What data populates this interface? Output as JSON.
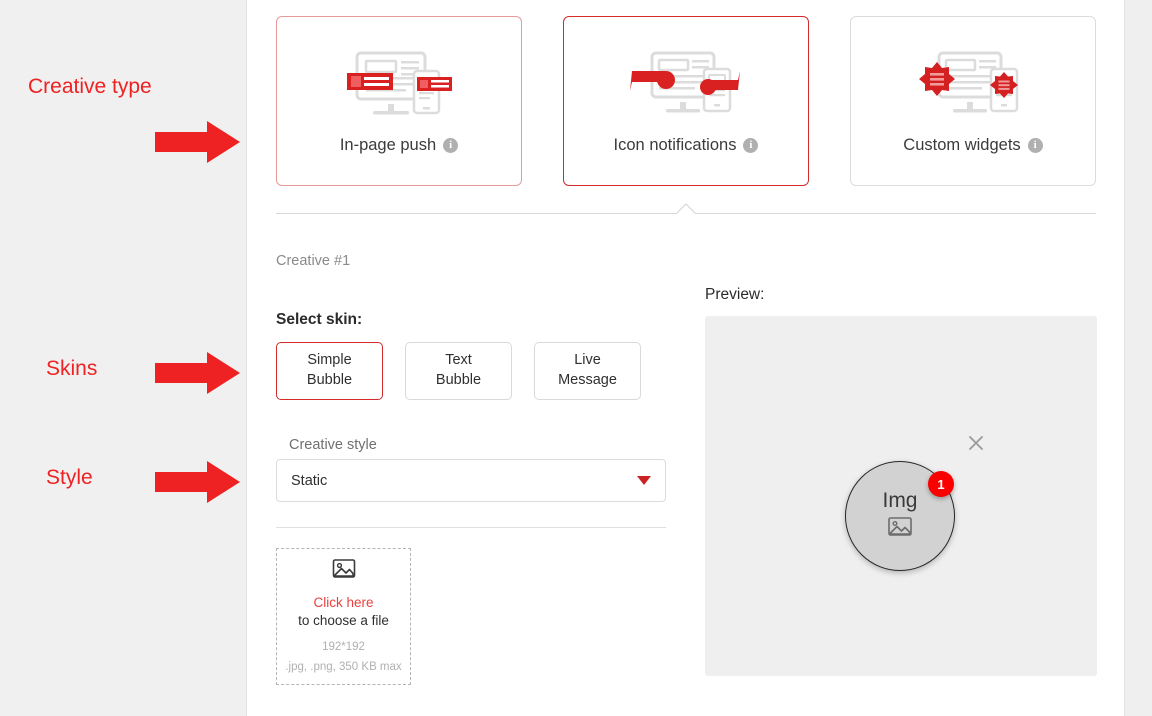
{
  "annotations": [
    {
      "label": "Creative type",
      "icon": "right-arrow-icon"
    },
    {
      "label": "Skins",
      "icon": "right-arrow-icon"
    },
    {
      "label": "Style",
      "icon": "right-arrow-icon"
    }
  ],
  "creative_type": {
    "cards": [
      {
        "label": "In-page push",
        "icon": "in-page-push-icon",
        "info": "i",
        "state": "soft-selected"
      },
      {
        "label": "Icon notifications",
        "icon": "icon-notifications-icon",
        "info": "i",
        "state": "selected"
      },
      {
        "label": "Custom widgets",
        "icon": "custom-widgets-icon",
        "info": "i",
        "state": "unselected"
      }
    ]
  },
  "creative": {
    "index_label": "Creative #1",
    "select_skin_label": "Select skin:",
    "skins": [
      {
        "line1": "Simple",
        "line2": "Bubble",
        "selected": true
      },
      {
        "line1": "Text",
        "line2": "Bubble",
        "selected": false
      },
      {
        "line1": "Live",
        "line2": "Message",
        "selected": false
      }
    ],
    "style": {
      "label": "Creative style",
      "value": "Static",
      "caret": "chevron-down-icon"
    },
    "upload": {
      "icon": "image-placeholder-icon",
      "click_text": "Click here",
      "sub_text": "to choose a file",
      "dimensions": "192*192",
      "constraints": ".jpg, .png, 350 KB max"
    }
  },
  "preview": {
    "label": "Preview:",
    "bubble_text": "Img",
    "bubble_icon": "image-placeholder-icon",
    "badge_count": "1",
    "close_icon": "close-icon"
  },
  "colors": {
    "accent_red": "#d42a2a",
    "annotation_red": "#ee2222",
    "badge_red": "#fb0000",
    "rail_gray": "#f0f0f0",
    "preview_gray": "#efefef"
  }
}
